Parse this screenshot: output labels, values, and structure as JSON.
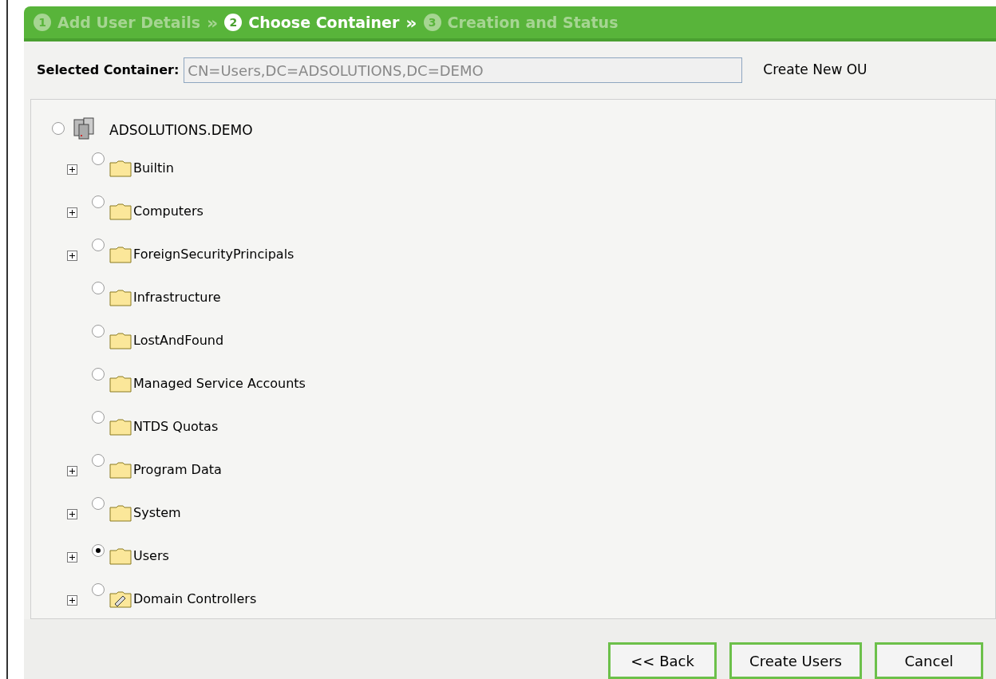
{
  "wizard_steps": [
    {
      "number": "1",
      "label": "Add User Details",
      "selected": false,
      "separator": "»"
    },
    {
      "number": "2",
      "label": "Choose Container",
      "selected": true,
      "separator": "»"
    },
    {
      "number": "3",
      "label": "Creation and Status",
      "selected": false
    }
  ],
  "selected_container": {
    "label": "Selected Container:",
    "value": "CN=Users,DC=ADSOLUTIONS,DC=DEMO"
  },
  "create_ou_link": "Create New OU",
  "tree": {
    "label": "ADSOLUTIONS.DEMO",
    "selected": false,
    "children": [
      {
        "label": "Builtin",
        "kind": "folder",
        "expandable": true,
        "selected": false
      },
      {
        "label": "Computers",
        "kind": "folder",
        "expandable": true,
        "selected": false
      },
      {
        "label": "ForeignSecurityPrincipals",
        "kind": "folder",
        "expandable": true,
        "selected": false
      },
      {
        "label": "Infrastructure",
        "kind": "folder",
        "expandable": false,
        "selected": false
      },
      {
        "label": "LostAndFound",
        "kind": "folder",
        "expandable": false,
        "selected": false
      },
      {
        "label": "Managed Service Accounts",
        "kind": "folder",
        "expandable": false,
        "selected": false
      },
      {
        "label": "NTDS Quotas",
        "kind": "folder",
        "expandable": false,
        "selected": false
      },
      {
        "label": "Program Data",
        "kind": "folder",
        "expandable": true,
        "selected": false
      },
      {
        "label": "System",
        "kind": "folder",
        "expandable": true,
        "selected": false
      },
      {
        "label": "Users",
        "kind": "folder",
        "expandable": true,
        "selected": true
      },
      {
        "label": "Domain Controllers",
        "kind": "ou",
        "expandable": true,
        "selected": false
      }
    ]
  },
  "buttons": [
    "<< Back",
    "Create Users",
    "Cancel"
  ]
}
